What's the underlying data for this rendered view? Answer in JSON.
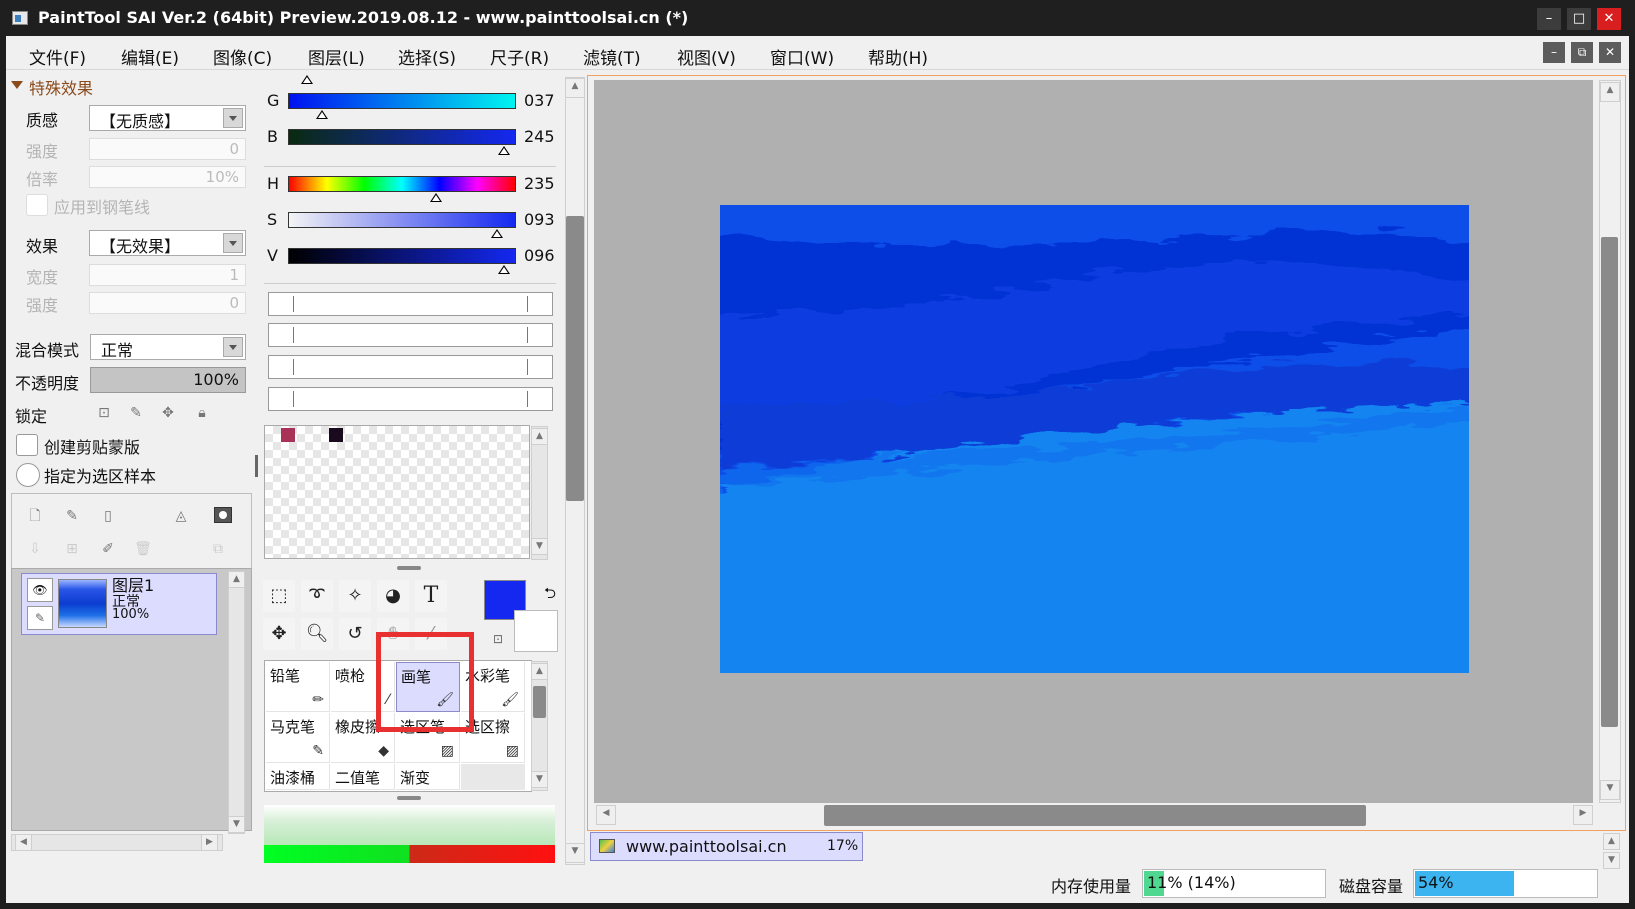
{
  "window": {
    "title": "PaintTool SAI Ver.2 (64bit) Preview.2019.08.12 - www.painttoolsai.cn (*)",
    "minimize": "–",
    "maximize": "□",
    "close": "✕"
  },
  "menu": [
    "文件(F)",
    "编辑(E)",
    "图像(C)",
    "图层(L)",
    "选择(S)",
    "尺子(R)",
    "滤镜(T)",
    "视图(V)",
    "窗口(W)",
    "帮助(H)"
  ],
  "mdi_buttons": [
    "–",
    "⧉",
    "✕"
  ],
  "effects": {
    "section": "特殊效果",
    "texture_label": "质感",
    "texture_value": "【无质感】",
    "strength_label": "强度",
    "strength_value": "0",
    "scale_label": "倍率",
    "scale_value": "10%",
    "apply_pen_label": "应用到钢笔线",
    "effect_label": "效果",
    "effect_value": "【无效果】",
    "width_label": "宽度",
    "width_value": "1",
    "strength2_label": "强度",
    "strength2_value": "0"
  },
  "layer_props": {
    "blend_label": "混合模式",
    "blend_value": "正常",
    "opacity_label": "不透明度",
    "opacity_value": "100%",
    "lock_label": "锁定",
    "clip_label": "创建剪贴蒙版",
    "sample_label": "指定为选区样本"
  },
  "layers": [
    {
      "name": "图层1",
      "mode": "正常",
      "opacity": "100%"
    }
  ],
  "color": {
    "sliders": [
      {
        "label": "G",
        "value": "037"
      },
      {
        "label": "B",
        "value": "245"
      },
      {
        "label": "H",
        "value": "235"
      },
      {
        "label": "S",
        "value": "093"
      },
      {
        "label": "V",
        "value": "096"
      }
    ],
    "main_color": "#1428f0",
    "swatches": [
      "#a83258",
      "#1a0a1e"
    ]
  },
  "brushes": [
    {
      "name": "铅笔"
    },
    {
      "name": "喷枪"
    },
    {
      "name": "画笔"
    },
    {
      "name": "水彩笔"
    },
    {
      "name": "马克笔"
    },
    {
      "name": "橡皮擦"
    },
    {
      "name": "选区笔"
    },
    {
      "name": "选区擦"
    },
    {
      "name": "油漆桶"
    },
    {
      "name": "二值笔"
    },
    {
      "name": "渐变"
    }
  ],
  "text_tool": "T",
  "status": {
    "doc_name": "www.painttoolsai.cn",
    "zoom": "17%",
    "memory_label": "内存使用量",
    "memory_value": "11% (14%)",
    "memory_level": 0.11,
    "disk_label": "磁盘容量",
    "disk_value": "54%",
    "disk_level": 0.54
  }
}
